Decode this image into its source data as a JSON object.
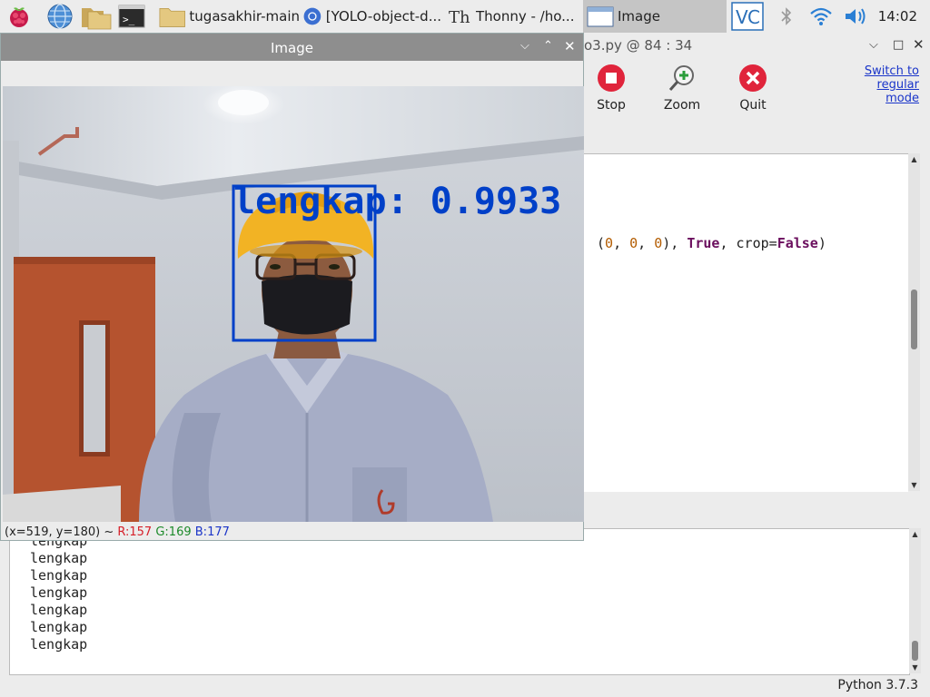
{
  "taskbar": {
    "tasks": [
      {
        "label": "tugasakhir-main",
        "icon": "folder-icon"
      },
      {
        "label": "[YOLO-object-d...",
        "icon": "chromium-icon"
      },
      {
        "label": "Thonny  -  /ho...",
        "icon": "thonny-icon"
      },
      {
        "label": "Image",
        "icon": "window-icon"
      }
    ],
    "launchers": [
      "raspberry-menu-icon",
      "web-browser-icon",
      "file-manager-icon",
      "terminal-icon"
    ],
    "tray": [
      "vnc-icon",
      "bluetooth-icon",
      "wifi-icon",
      "volume-icon"
    ],
    "clock": "14:02"
  },
  "thonny": {
    "title": "o3.py  @  84 : 34",
    "toolbar": {
      "stop": "Stop",
      "zoom": "Zoom",
      "quit": "Quit"
    },
    "switch_mode": [
      "Switch to",
      "regular",
      "mode"
    ],
    "code_line": {
      "t1": "(",
      "n1": "0",
      "t2": ", ",
      "n2": "0",
      "t3": ", ",
      "n3": "0",
      "t4": "), ",
      "k1": "True",
      "t5": ", crop=",
      "k2": "False",
      "t6": ")"
    },
    "shell_lines": [
      "lengkap",
      "lengkap",
      "lengkap",
      "lengkap",
      "lengkap",
      "lengkap",
      "lengkap"
    ],
    "python_version": "Python 3.7.3"
  },
  "image_window": {
    "title": "Image",
    "detection": {
      "label": "lengkap: 0.9933",
      "color": "#0040c8"
    },
    "coords": {
      "pos": "(x=519, y=180) ~",
      "r": "R:157",
      "g": "G:169",
      "b": "B:177"
    }
  },
  "colors": {
    "accent": "#1a35c9",
    "stop_red": "#e0243b",
    "box_blue": "#0040c8"
  }
}
